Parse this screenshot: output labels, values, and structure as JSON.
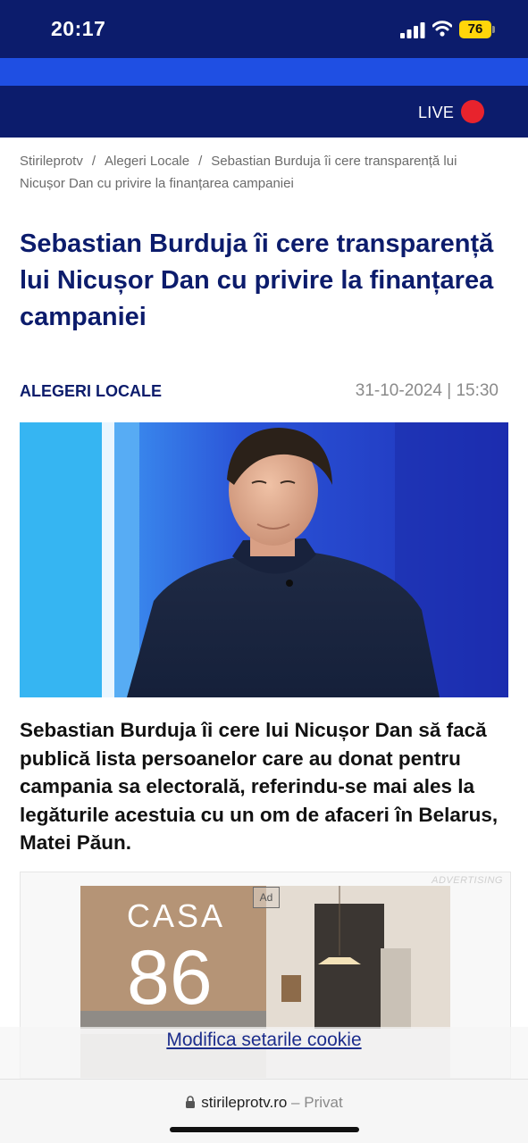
{
  "status_bar": {
    "time": "20:17",
    "battery": "76",
    "icons": [
      "signal-icon",
      "wifi-icon",
      "battery-icon"
    ]
  },
  "navbar": {
    "live_label": "LIVE",
    "live_color": "#e8232d",
    "brand_color": "#0c1c6c",
    "accent_color": "#1f4fe3"
  },
  "breadcrumb": {
    "items": [
      "Stirileprotv",
      "Alegeri Locale",
      "Sebastian Burduja îi cere transparență lui Nicușor Dan cu privire la finanțarea campaniei"
    ],
    "separator": "/"
  },
  "article": {
    "title": "Sebastian Burduja îi cere transparență lui Nicușor Dan cu privire la finanțarea campaniei",
    "category": "ALEGERI LOCALE",
    "date": "31-10-2024 | 15:30",
    "lead": "Sebastian Burduja îi cere lui Nicușor Dan să facă publică lista persoanelor care au donat pentru campania sa electorală, referindu-se mai ales la legăturile acestuia cu un om de afaceri în Belarus, Matei Păun."
  },
  "ad": {
    "label": "ADVERTISING",
    "badge": "Ad",
    "brand_line1": "CASA",
    "brand_line2": "86"
  },
  "cookie": {
    "link_text": "Modifica setarile cookie"
  },
  "browser": {
    "domain": "stirileprotv.ro",
    "separator": "–",
    "mode": "Privat"
  }
}
